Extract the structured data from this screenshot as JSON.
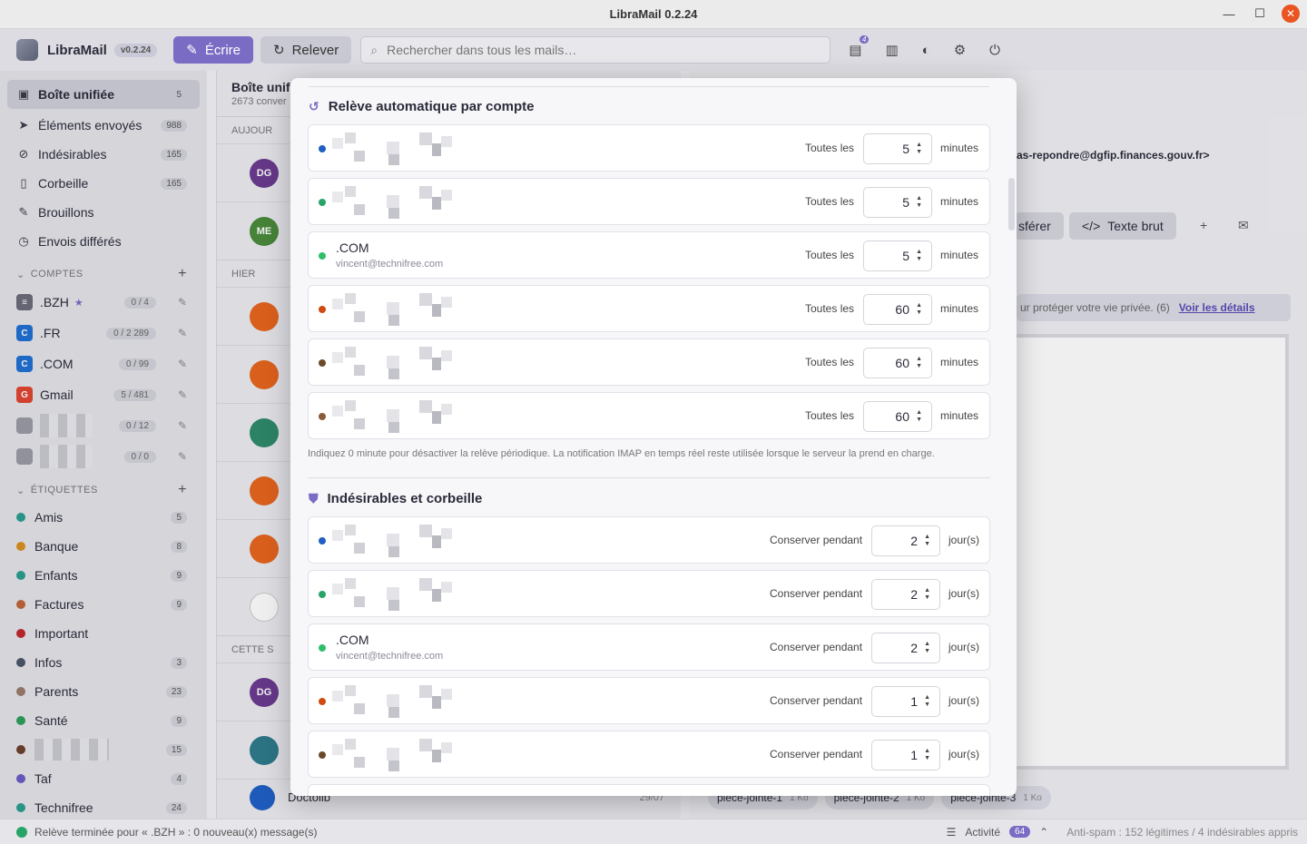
{
  "window": {
    "title": "LibraMail 0.2.24",
    "minimize": "—",
    "maximize": "☐",
    "close": "✕"
  },
  "app": {
    "name": "LibraMail",
    "version": "v0.2.24",
    "write_label": "Écrire",
    "fetch_label": "Relever",
    "search_placeholder": "Rechercher dans tous les mails…",
    "notif_badge": "4"
  },
  "sidebar": {
    "folders": [
      {
        "label": "Boîte unifiée",
        "count": "5",
        "icon": "inbox-icon",
        "glyph": "▣"
      },
      {
        "label": "Éléments envoyés",
        "count": "988",
        "icon": "send-icon",
        "glyph": "➤"
      },
      {
        "label": "Indésirables",
        "count": "165",
        "icon": "block-icon",
        "glyph": "⊘"
      },
      {
        "label": "Corbeille",
        "count": "165",
        "icon": "trash-icon",
        "glyph": "🗑"
      },
      {
        "label": "Brouillons",
        "count": "",
        "icon": "draft-icon",
        "glyph": "✎"
      },
      {
        "label": "Envois différés",
        "count": "",
        "icon": "clock-icon",
        "glyph": "◷"
      }
    ],
    "accounts_header": "COMPTES",
    "accounts": [
      {
        "label": ".BZH",
        "count": "0 / 4",
        "color": "#6a6a78",
        "star": "★"
      },
      {
        "label": ".FR",
        "count": "0 / 2 289",
        "color": "#1f6fd1"
      },
      {
        "label": ".COM",
        "count": "0 / 99",
        "color": "#1f6fd1"
      },
      {
        "label": "Gmail",
        "count": "5 / 481",
        "color": "#e0442f"
      },
      {
        "label": "",
        "count": "0 / 12",
        "color": "#9a9aa4"
      },
      {
        "label": "",
        "count": "0 / 0",
        "color": "#9a9aa4"
      }
    ],
    "labels_header": "ÉTIQUETTES",
    "labels": [
      {
        "label": "Amis",
        "count": "5",
        "color": "#2a9d8f"
      },
      {
        "label": "Banque",
        "count": "8",
        "color": "#d9901f"
      },
      {
        "label": "Enfants",
        "count": "9",
        "color": "#2a9d8f"
      },
      {
        "label": "Factures",
        "count": "9",
        "color": "#c0643a"
      },
      {
        "label": "Important",
        "count": "",
        "color": "#c0262d"
      },
      {
        "label": "Infos",
        "count": "3",
        "color": "#4a5568"
      },
      {
        "label": "Parents",
        "count": "23",
        "color": "#9a7a6a"
      },
      {
        "label": "Santé",
        "count": "9",
        "color": "#2f9e5a"
      },
      {
        "label": "",
        "count": "15",
        "color": "#6b3f2a"
      },
      {
        "label": "Taf",
        "count": "4",
        "color": "#6a5ac4"
      },
      {
        "label": "Technifree",
        "count": "24",
        "color": "#2a9d8f"
      }
    ]
  },
  "list": {
    "title": "Boîte unif",
    "subtitle": "2673 conver",
    "groups": [
      "AUJOUR",
      "HIER",
      "CETTE S"
    ],
    "avatars": [
      {
        "initials": "DG",
        "color": "#6b3a8e"
      },
      {
        "initials": "ME",
        "color": "#4a8a3a"
      }
    ],
    "bottom_sender": "Doctolib",
    "bottom_date": "29/07"
  },
  "reader": {
    "from_fragment": "as-repondre@dgfip.finances.gouv.fr>",
    "forward_fragment": "sférer",
    "raw_text": "Texte brut",
    "privacy_fragment": "ur protéger votre vie privée. (6)",
    "privacy_link": "Voir les détails",
    "attachments": [
      {
        "name": "piece-jointe-1",
        "size": "1 Ko"
      },
      {
        "name": "piece-jointe-2",
        "size": "1 Ko"
      },
      {
        "name": "piece-jointe-3",
        "size": "1 Ko"
      }
    ]
  },
  "modal": {
    "fetch_section_title": "Relève automatique par compte",
    "fetch_label": "Toutes les",
    "fetch_unit": "minutes",
    "fetch_rows": [
      {
        "name": "",
        "email": "",
        "value": "5",
        "color": "#1f5fc4"
      },
      {
        "name": "",
        "email": "",
        "value": "5",
        "color": "#27a567"
      },
      {
        "name": ".COM",
        "email": "vincent@technifree.com",
        "value": "5",
        "color": "#2fbf6a"
      },
      {
        "name": "",
        "email": "",
        "value": "60",
        "color": "#d04a14"
      },
      {
        "name": "",
        "email": "",
        "value": "60",
        "color": "#6b4a2a"
      },
      {
        "name": "",
        "email": "",
        "value": "60",
        "color": "#8a5a3a"
      }
    ],
    "fetch_hint": "Indiquez 0 minute pour désactiver la relève périodique. La notification IMAP en temps réel reste utilisée lorsque le serveur la prend en charge.",
    "junk_section_title": "Indésirables et corbeille",
    "junk_label": "Conserver pendant",
    "junk_unit": "jour(s)",
    "junk_rows": [
      {
        "name": "",
        "email": "",
        "value": "2",
        "color": "#1f5fc4"
      },
      {
        "name": "",
        "email": "",
        "value": "2",
        "color": "#27a567"
      },
      {
        "name": ".COM",
        "email": "vincent@technifree.com",
        "value": "2",
        "color": "#2fbf6a"
      },
      {
        "name": "",
        "email": "",
        "value": "1",
        "color": "#d04a14"
      },
      {
        "name": "",
        "email": "",
        "value": "1",
        "color": "#6b4a2a"
      }
    ]
  },
  "status": {
    "message": "Relève terminée pour « .BZH » : 0 nouveau(x) message(s)",
    "activity_label": "Activité",
    "activity_count": "64",
    "antispam": "Anti-spam : 152 légitimes / 4 indésirables appris"
  }
}
